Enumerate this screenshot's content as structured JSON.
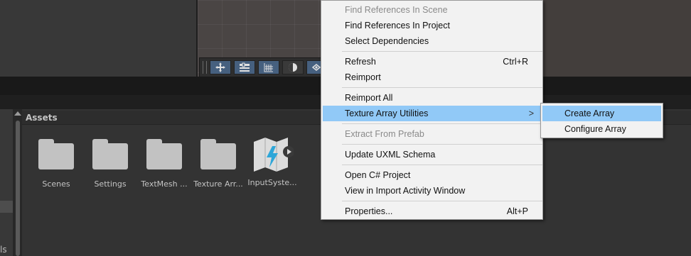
{
  "context_menu": {
    "items": [
      {
        "label": "Find References In Scene",
        "disabled": true
      },
      {
        "label": "Find References In Project"
      },
      {
        "label": "Select Dependencies"
      },
      {
        "label": "Refresh",
        "shortcut": "Ctrl+R"
      },
      {
        "label": "Reimport"
      },
      {
        "label": "Reimport All"
      },
      {
        "label": "Texture Array Utilities",
        "highlighted": true,
        "has_submenu": true,
        "arrow": ">"
      },
      {
        "label": "Extract From Prefab",
        "disabled": true
      },
      {
        "label": "Update UXML Schema"
      },
      {
        "label": "Open C# Project"
      },
      {
        "label": "View in Import Activity Window"
      },
      {
        "label": "Properties...",
        "shortcut": "Alt+P"
      }
    ]
  },
  "submenu": {
    "items": [
      {
        "label": "Create Array",
        "highlighted": true
      },
      {
        "label": "Configure Array"
      }
    ]
  },
  "assets": {
    "header": "Assets",
    "items": [
      {
        "label": "Scenes",
        "icon": "folder-icon"
      },
      {
        "label": "Settings",
        "icon": "folder-icon"
      },
      {
        "label": "TextMesh ...",
        "icon": "folder-icon"
      },
      {
        "label": "Texture Arr...",
        "icon": "folder-icon"
      },
      {
        "label": "InputSyste...",
        "icon": "input-system-asset-icon"
      }
    ]
  },
  "tree_panel": {
    "partial_label": "ls"
  },
  "scene_toolbar": {
    "tools": [
      "move-tool-icon",
      "rect-tool-icon",
      "grid-snap-icon",
      "shading-mode-icon",
      "gizmo-icon"
    ]
  },
  "colors": {
    "menu_highlight": "#91c9f7",
    "menu_bg": "#f2f2f2",
    "editor_bg": "#333333",
    "tool_active": "#46607f"
  }
}
